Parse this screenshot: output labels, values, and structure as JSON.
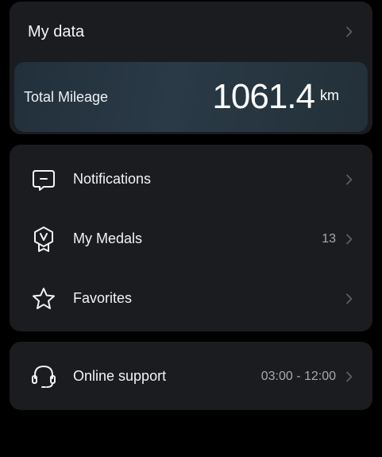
{
  "my_data": {
    "title": "My data",
    "mileage_label": "Total Mileage",
    "mileage_value": "1061.4",
    "mileage_unit": "km"
  },
  "menu": {
    "items": [
      {
        "label": "Notifications",
        "icon": "message-icon",
        "value": ""
      },
      {
        "label": "My Medals",
        "icon": "medal-icon",
        "value": "13"
      },
      {
        "label": "Favorites",
        "icon": "star-icon",
        "value": ""
      }
    ]
  },
  "support": {
    "label": "Online support",
    "icon": "headset-icon",
    "hours": "03:00 - 12:00"
  },
  "colors": {
    "background": "#000000",
    "card": "#1b1c20",
    "mileage_banner": "#2a3a46",
    "text": "#f2f3f5",
    "secondary_text": "#a7a9ae",
    "chevron": "#5c5e63"
  }
}
